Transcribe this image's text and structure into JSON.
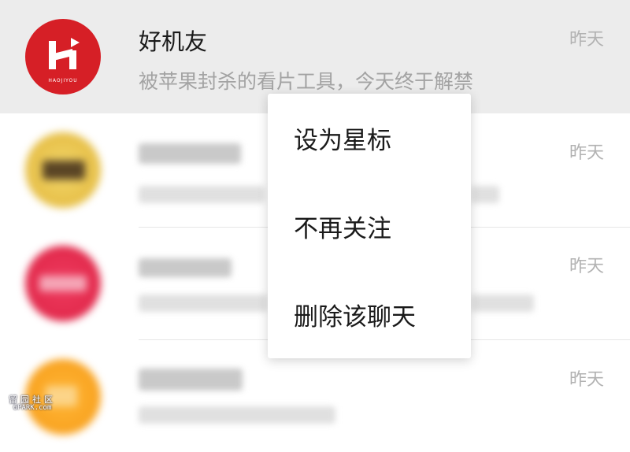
{
  "chats": [
    {
      "name": "好机友",
      "preview": "被苹果封杀的看片工具，今天终于解禁",
      "time": "昨天",
      "avatar_logo_text": "HAOJIYOU",
      "avatar_color": "#d61f26",
      "selected": true
    },
    {
      "name": "",
      "preview": "",
      "time": "昨天",
      "avatar_color": "#e8c24c",
      "obscured": true
    },
    {
      "name": "",
      "preview": "",
      "time": "昨天",
      "avatar_color": "#e22a4c",
      "obscured": true
    },
    {
      "name": "",
      "preview": "",
      "time": "昨天",
      "avatar_color": "#f9a321",
      "obscured": true
    }
  ],
  "context_menu": {
    "items": [
      {
        "label": "设为星标"
      },
      {
        "label": "不再关注"
      },
      {
        "label": "删除该聊天"
      }
    ]
  },
  "watermark": {
    "cn": "留园社区",
    "en": "6PARK.com"
  }
}
